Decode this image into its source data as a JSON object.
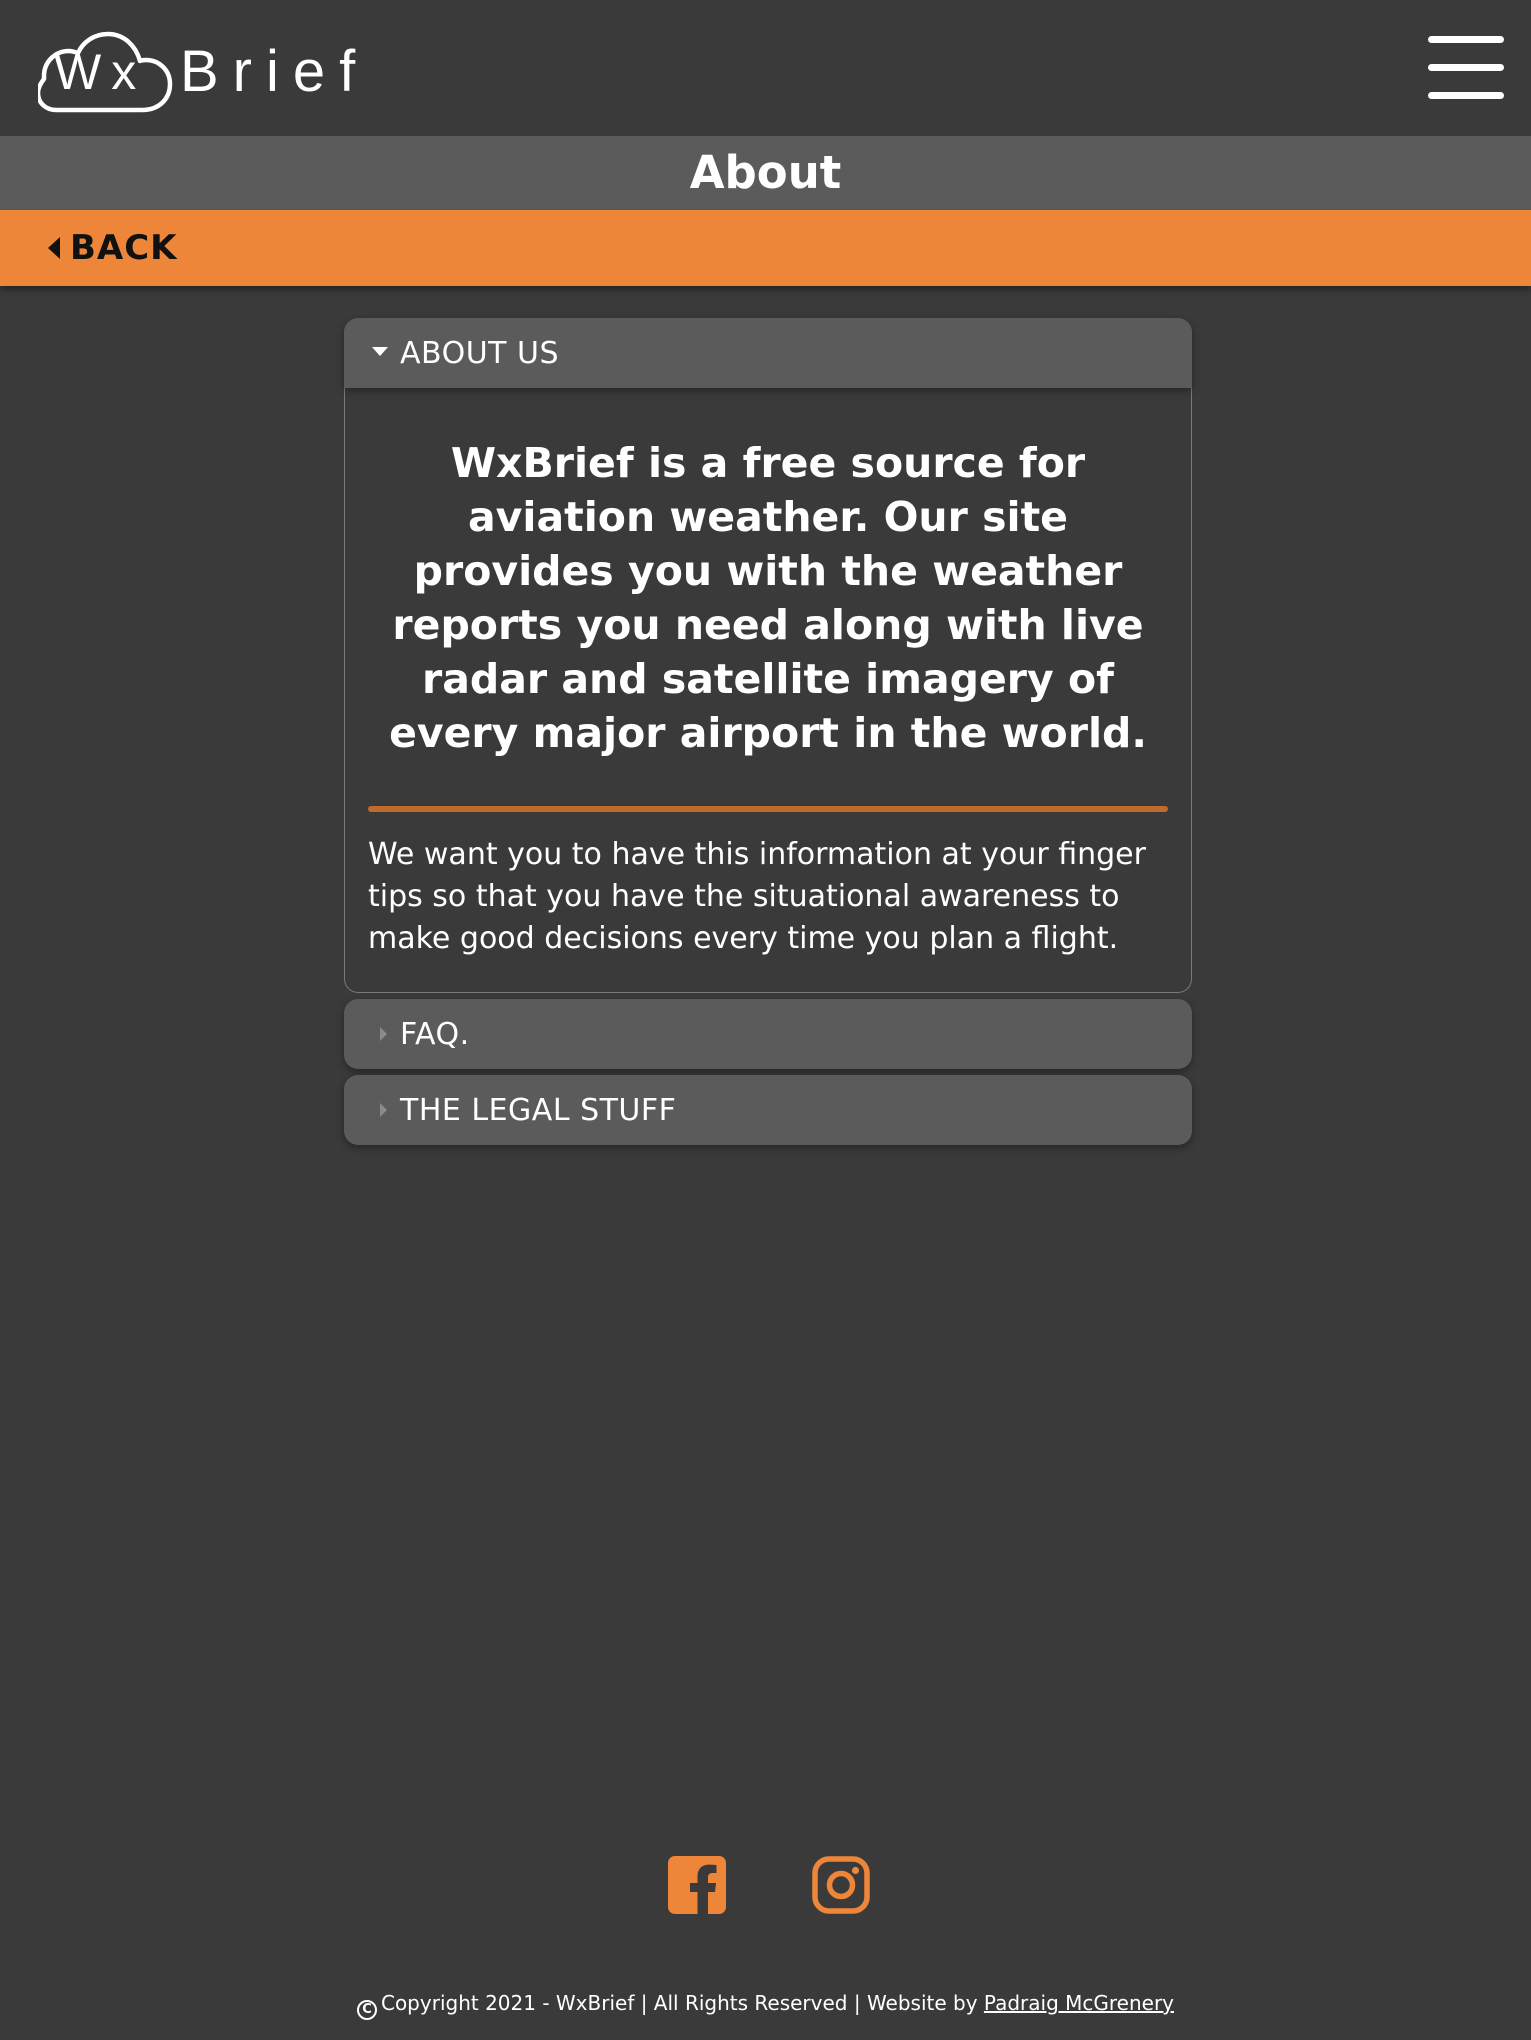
{
  "header": {
    "logo_wx": "Wx",
    "logo_brief": "Brief",
    "menu_icon": "hamburger-menu-icon"
  },
  "page": {
    "title": "About"
  },
  "nav": {
    "back_label": "BACK",
    "back_icon": "caret-left-icon"
  },
  "accordion": {
    "items": [
      {
        "title": "ABOUT US",
        "expanded": true,
        "icon": "caret-down-icon",
        "lead": "WxBrief is a free source for aviation weather. Our site provides you with the weather reports you need along with live radar and satellite imagery of every major airport in the world.",
        "body": "We want you to have this information at your finger tips so that you have the situational awareness to make good decisions every time you plan a flight."
      },
      {
        "title": "FAQ.",
        "expanded": false,
        "icon": "caret-right-icon"
      },
      {
        "title": "THE LEGAL STUFF",
        "expanded": false,
        "icon": "caret-right-icon"
      }
    ]
  },
  "footer": {
    "social": [
      {
        "icon": "facebook-icon"
      },
      {
        "icon": "instagram-icon"
      }
    ],
    "copyright_text": "Copyright 2021 - WxBrief | All Rights Reserved | Website by",
    "author_link": "Padraig McGrenery"
  },
  "colors": {
    "background": "#3a3a3a",
    "title_bar": "#5b5b5b",
    "accent": "#ee863a",
    "divider": "#c06a2c",
    "text": "#ffffff"
  }
}
